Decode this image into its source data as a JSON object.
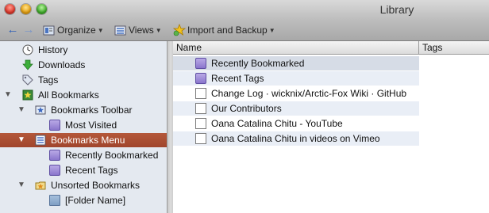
{
  "window": {
    "title": "Library"
  },
  "toolbar": {
    "back_icon": "back-arrow-icon",
    "forward_icon": "forward-arrow-icon",
    "organize": "Organize",
    "views": "Views",
    "import_backup": "Import and Backup"
  },
  "sidebar": {
    "items": [
      {
        "label": "History",
        "icon": "clock-icon"
      },
      {
        "label": "Downloads",
        "icon": "download-icon"
      },
      {
        "label": "Tags",
        "icon": "tag-icon"
      },
      {
        "label": "All Bookmarks",
        "icon": "star-folder-icon"
      },
      {
        "label": "Bookmarks Toolbar",
        "icon": "star-icon"
      },
      {
        "label": "Most Visited",
        "icon": "smart-folder-icon"
      },
      {
        "label": "Bookmarks Menu",
        "icon": "menu-icon"
      },
      {
        "label": "Recently Bookmarked",
        "icon": "smart-folder-icon"
      },
      {
        "label": "Recent Tags",
        "icon": "smart-folder-icon"
      },
      {
        "label": "Unsorted Bookmarks",
        "icon": "unsorted-folder-icon"
      },
      {
        "label": "[Folder Name]",
        "icon": "folder-icon"
      }
    ],
    "selected": "Bookmarks Menu"
  },
  "list": {
    "columns": [
      "Name",
      "Tags"
    ],
    "rows": [
      {
        "name": "Recently Bookmarked",
        "icon": "smart-folder-icon"
      },
      {
        "name": "Recent Tags",
        "icon": "smart-folder-icon"
      },
      {
        "name": "Change Log · wicknix/Arctic-Fox Wiki · GitHub",
        "icon": "page-icon"
      },
      {
        "name": "Our Contributors",
        "icon": "page-icon"
      },
      {
        "name": "Oana Catalina Chitu - YouTube",
        "icon": "page-icon"
      },
      {
        "name": "Oana Catalina Chitu in videos on Vimeo",
        "icon": "page-icon"
      }
    ]
  },
  "colors": {
    "selection": "#a8492f",
    "accent": "#2d5fb8",
    "alt_row": "#e9eef6"
  }
}
